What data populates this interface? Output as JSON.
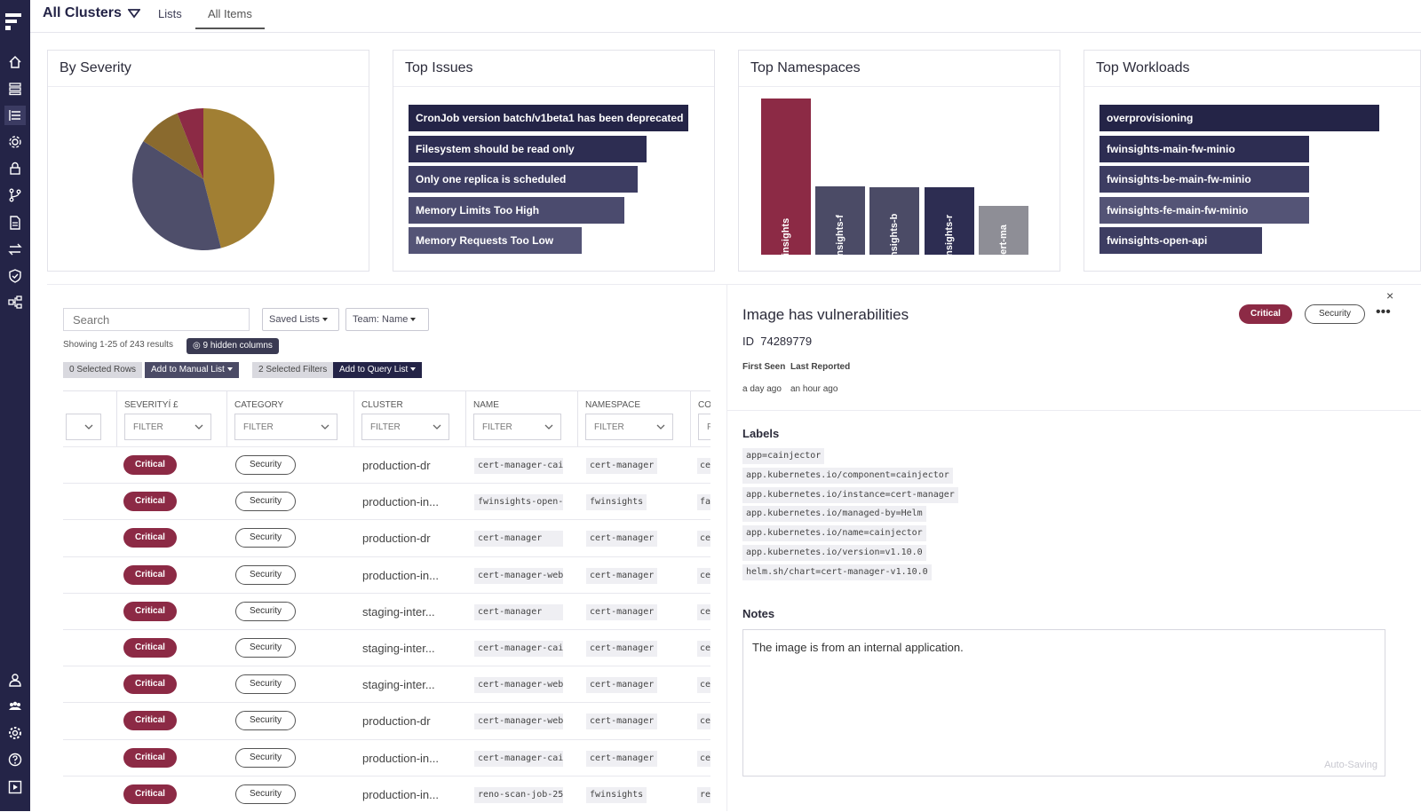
{
  "app": {
    "title": "All Clusters",
    "tabs": [
      {
        "label": "Lists"
      },
      {
        "label": "All Items"
      }
    ]
  },
  "sidebar": {
    "icons": [
      "logo-icon",
      "home-icon",
      "server-icon",
      "list-icon",
      "gear-icon",
      "lock-icon",
      "branch-icon",
      "document-icon",
      "transfer-icon",
      "shield-icon",
      "org-chart-icon",
      "user-icon",
      "team-icon",
      "settings-icon",
      "help-icon",
      "play-icon"
    ]
  },
  "cards": {
    "severity": {
      "title": "By Severity"
    },
    "issues": {
      "title": "Top Issues"
    },
    "namespaces": {
      "title": "Top Namespaces"
    },
    "workloads": {
      "title": "Top Workloads"
    }
  },
  "chart_data": [
    {
      "type": "pie",
      "title": "By Severity",
      "slices": [
        {
          "value": 0.46,
          "color": "#a17f33"
        },
        {
          "value": 0.38,
          "color": "#4e4e6a"
        },
        {
          "value": 0.1,
          "color": "#8a6a2e"
        },
        {
          "value": 0.06,
          "color": "#8c2a45"
        }
      ]
    },
    {
      "type": "bar",
      "orientation": "horizontal",
      "title": "Top Issues",
      "categories": [
        "CronJob version batch/v1beta1 has been deprecated",
        "Filesystem should be read only",
        "Only one replica is scheduled",
        "Memory Limits Too High",
        "Memory Requests Too Low"
      ],
      "values": [
        100,
        85,
        82,
        77,
        62
      ],
      "colors": [
        "#242447",
        "#2d2d52",
        "#3d3d62",
        "#4b4b6e",
        "#545476"
      ]
    },
    {
      "type": "bar",
      "orientation": "vertical",
      "title": "Top Namespaces",
      "categories": [
        "fwinsights",
        "fwinsights-f",
        "fwinsights-b",
        "fwinsights-r",
        "cert-ma"
      ],
      "values": [
        100,
        44,
        43,
        43,
        31
      ],
      "colors": [
        "#8c2a45",
        "#4b4b66",
        "#4b4b66",
        "#2d2d52",
        "#8e8e96"
      ]
    },
    {
      "type": "bar",
      "orientation": "horizontal",
      "title": "Top Workloads",
      "categories": [
        "overprovisioning",
        "fwinsights-main-fw-minio",
        "fwinsights-be-main-fw-minio",
        "fwinsights-fe-main-fw-minio",
        "fwinsights-open-api"
      ],
      "values": [
        100,
        75,
        75,
        75,
        58
      ],
      "colors": [
        "#242447",
        "#2d2d52",
        "#3d3d62",
        "#545476",
        "#3d3d62"
      ]
    }
  ],
  "toolbar": {
    "search_placeholder": "Search",
    "saved_lists": "Saved Lists",
    "team": "Team: Name",
    "showing": "Showing 1-25 of 243 results",
    "hidden_columns": "9 hidden columns",
    "selected_rows": "0 Selected Rows",
    "add_manual": "Add to Manual List",
    "selected_filters": "2 Selected Filters",
    "add_query": "Add to Query List"
  },
  "table": {
    "columns": [
      {
        "label": "",
        "filter": ""
      },
      {
        "label": "SEVERITYÍ   £",
        "filter": "FILTER"
      },
      {
        "label": "CATEGORY",
        "filter": "FILTER"
      },
      {
        "label": "CLUSTER",
        "filter": "FILTER"
      },
      {
        "label": "NAME",
        "filter": "FILTER"
      },
      {
        "label": "NAMESPACE",
        "filter": "FILTER"
      },
      {
        "label": "CO",
        "filter": "F"
      }
    ],
    "rows": [
      {
        "severity": "Critical",
        "category": "Security",
        "cluster": "production-dr",
        "name": "cert-manager-cai",
        "namespace": "cert-manager",
        "extra": "ce"
      },
      {
        "severity": "Critical",
        "category": "Security",
        "cluster": "production-in...",
        "name": "fwinsights-open-",
        "namespace": "fwinsights",
        "extra": "fa"
      },
      {
        "severity": "Critical",
        "category": "Security",
        "cluster": "production-dr",
        "name": "cert-manager",
        "namespace": "cert-manager",
        "extra": "ce"
      },
      {
        "severity": "Critical",
        "category": "Security",
        "cluster": "production-in...",
        "name": "cert-manager-web",
        "namespace": "cert-manager",
        "extra": "ce"
      },
      {
        "severity": "Critical",
        "category": "Security",
        "cluster": "staging-inter...",
        "name": "cert-manager",
        "namespace": "cert-manager",
        "extra": "ce"
      },
      {
        "severity": "Critical",
        "category": "Security",
        "cluster": "staging-inter...",
        "name": "cert-manager-cai",
        "namespace": "cert-manager",
        "extra": "ce"
      },
      {
        "severity": "Critical",
        "category": "Security",
        "cluster": "staging-inter...",
        "name": "cert-manager-web",
        "namespace": "cert-manager",
        "extra": "ce"
      },
      {
        "severity": "Critical",
        "category": "Security",
        "cluster": "production-dr",
        "name": "cert-manager-web",
        "namespace": "cert-manager",
        "extra": "ce"
      },
      {
        "severity": "Critical",
        "category": "Security",
        "cluster": "production-in...",
        "name": "cert-manager-cai",
        "namespace": "cert-manager",
        "extra": "ce"
      },
      {
        "severity": "Critical",
        "category": "Security",
        "cluster": "production-in...",
        "name": "reno-scan-job-25",
        "namespace": "fwinsights",
        "extra": "re"
      }
    ]
  },
  "detail": {
    "title": "Image has vulnerabilities",
    "severity": "Critical",
    "category": "Security",
    "more": "•••",
    "close": "×",
    "id_label": "ID",
    "id": "74289779",
    "first_seen_label": "First Seen",
    "last_reported_label": "Last Reported",
    "first_seen": "a day ago",
    "last_reported": "an hour ago",
    "labels_heading": "Labels",
    "labels": [
      "app=cainjector",
      "app.kubernetes.io/component=cainjector",
      "app.kubernetes.io/instance=cert-manager",
      "app.kubernetes.io/managed-by=Helm",
      "app.kubernetes.io/name=cainjector",
      "app.kubernetes.io/version=v1.10.0",
      "helm.sh/chart=cert-manager-v1.10.0"
    ],
    "notes_heading": "Notes",
    "notes": "The image is from an internal application.",
    "auto_saving": "Auto-Saving"
  }
}
